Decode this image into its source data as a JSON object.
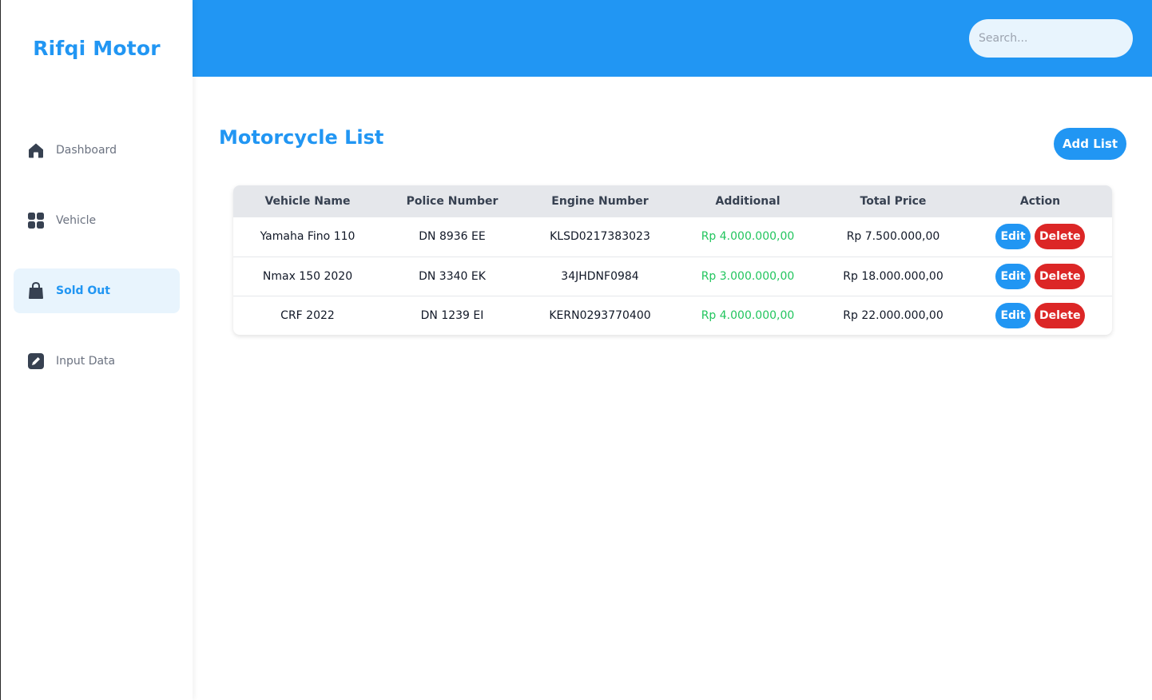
{
  "brand": "Rifqi Motor",
  "sidebar": {
    "items": [
      {
        "label": "Dashboard",
        "icon": "home-icon",
        "active": false
      },
      {
        "label": "Vehicle",
        "icon": "grid-icon",
        "active": false
      },
      {
        "label": "Sold Out",
        "icon": "shopping-bag-icon",
        "active": true
      },
      {
        "label": "Input Data",
        "icon": "edit-icon",
        "active": false
      }
    ]
  },
  "header": {
    "search_placeholder": "Search..."
  },
  "main": {
    "title": "Motorcycle List",
    "add_button": "Add List",
    "table": {
      "columns": [
        "Vehicle Name",
        "Police Number",
        "Engine Number",
        "Additional",
        "Total Price",
        "Action"
      ],
      "rows": [
        {
          "vehicle_name": "Yamaha Fino 110",
          "police_number": "DN 8936 EE",
          "engine_number": "KLSD0217383023",
          "additional": "Rp 4.000.000,00",
          "total_price": "Rp 7.500.000,00",
          "edit": "Edit",
          "delete": "Delete"
        },
        {
          "vehicle_name": "Nmax 150 2020",
          "police_number": "DN 3340 EK",
          "engine_number": "34JHDNF0984",
          "additional": "Rp 3.000.000,00",
          "total_price": "Rp 18.000.000,00",
          "edit": "Edit",
          "delete": "Delete"
        },
        {
          "vehicle_name": "CRF 2022",
          "police_number": "DN 1239 EI",
          "engine_number": "KERN0293770400",
          "additional": "Rp 4.000.000,00",
          "total_price": "Rp 22.000.000,00",
          "edit": "Edit",
          "delete": "Delete"
        }
      ]
    }
  },
  "colors": {
    "primary": "#2196f3",
    "danger": "#dc2626",
    "success": "#22c55e",
    "active_bg": "#e8f4fd"
  }
}
